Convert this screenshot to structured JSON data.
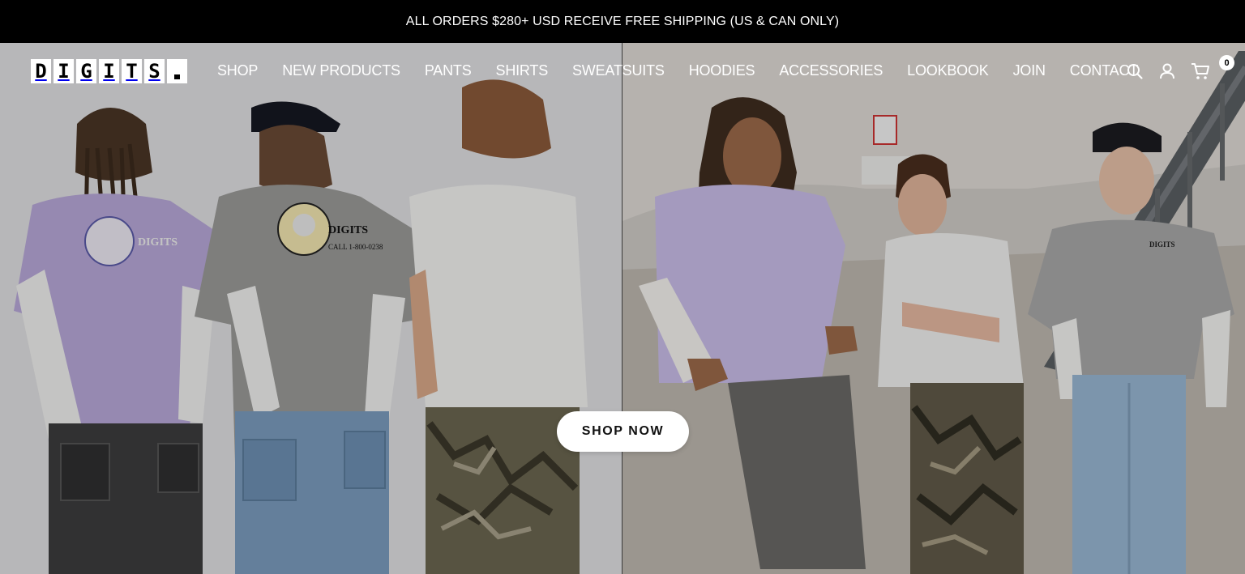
{
  "announcement": "ALL ORDERS $280+ USD RECEIVE FREE SHIPPING (US & CAN ONLY)",
  "brand": {
    "letters": [
      "D",
      "I",
      "G",
      "I",
      "T",
      "S",
      "."
    ],
    "name": "DIGITS."
  },
  "nav": {
    "items": [
      {
        "label": "SHOP"
      },
      {
        "label": "NEW PRODUCTS"
      },
      {
        "label": "PANTS"
      },
      {
        "label": "SHIRTS"
      },
      {
        "label": "SWEATSUITS"
      },
      {
        "label": "HOODIES"
      },
      {
        "label": "ACCESSORIES"
      },
      {
        "label": "LOOKBOOK"
      },
      {
        "label": "JOIN"
      },
      {
        "label": "CONTACT"
      }
    ]
  },
  "header_icons": {
    "search": "search-icon",
    "account": "account-icon",
    "cart": "cart-icon",
    "cart_count": "0"
  },
  "hero": {
    "cta_label": "SHOP NOW",
    "left_image": "three-models-back-view-photo",
    "right_image": "three-models-leaning-wall-photo"
  },
  "colors": {
    "announcement_bg": "#000000",
    "nav_text": "#ffffff",
    "cta_bg": "#ffffff"
  }
}
